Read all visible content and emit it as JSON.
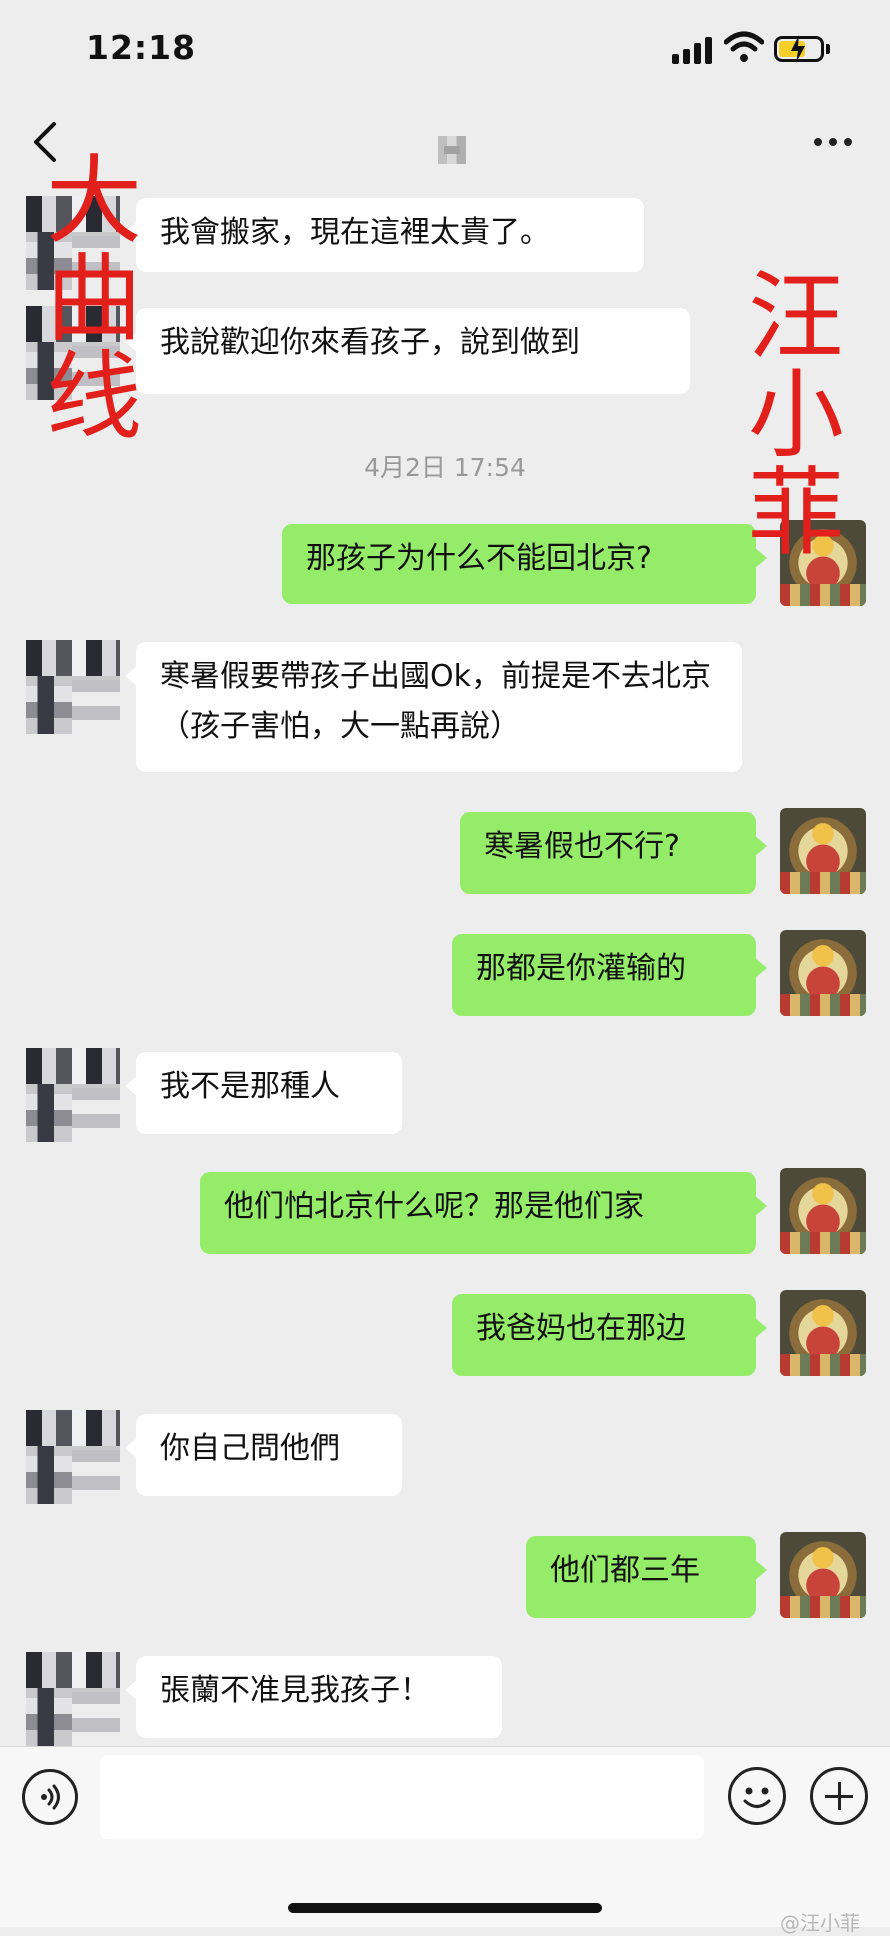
{
  "status_bar": {
    "time": "12:18"
  },
  "messages": [
    {
      "id": 1,
      "side": "in",
      "text": "我會搬家，現在這裡太貴了。"
    },
    {
      "id": 2,
      "side": "in",
      "text": "我說歡迎你來看孩子，說到做到"
    },
    {
      "id": 3,
      "side": "out",
      "text": "那孩子为什么不能回北京?"
    },
    {
      "id": 4,
      "side": "in",
      "text": "寒暑假要帶孩子出國Ok，前提是不去北京（孩子害怕，大一點再說）"
    },
    {
      "id": 5,
      "side": "out",
      "text": "寒暑假也不行?"
    },
    {
      "id": 6,
      "side": "out",
      "text": "那都是你灌输的"
    },
    {
      "id": 7,
      "side": "in",
      "text": "我不是那種人"
    },
    {
      "id": 8,
      "side": "out",
      "text": "他们怕北京什么呢？那是他们家"
    },
    {
      "id": 9,
      "side": "out",
      "text": "我爸妈也在那边"
    },
    {
      "id": 10,
      "side": "in",
      "text": "你自己問他們"
    },
    {
      "id": 11,
      "side": "out",
      "text": "他们都三年"
    },
    {
      "id": 12,
      "side": "in",
      "text": "張蘭不准見我孩子！"
    }
  ],
  "timestamp": "4月2日 17:54",
  "annotations": {
    "left": [
      "大",
      "曲",
      "线"
    ],
    "right": [
      "汪",
      "小",
      "菲"
    ]
  },
  "input": {
    "value": ""
  },
  "watermark": "@汪小菲",
  "icons": {
    "back": "back-chevron-icon",
    "more": "more-dots-icon",
    "voice": "voice-icon",
    "emoji": "emoji-icon",
    "plus": "plus-icon"
  },
  "colors": {
    "incoming_bubble": "#ffffff",
    "outgoing_bubble": "#95ec69",
    "annotation": "#e2201b",
    "background": "#ededed"
  }
}
